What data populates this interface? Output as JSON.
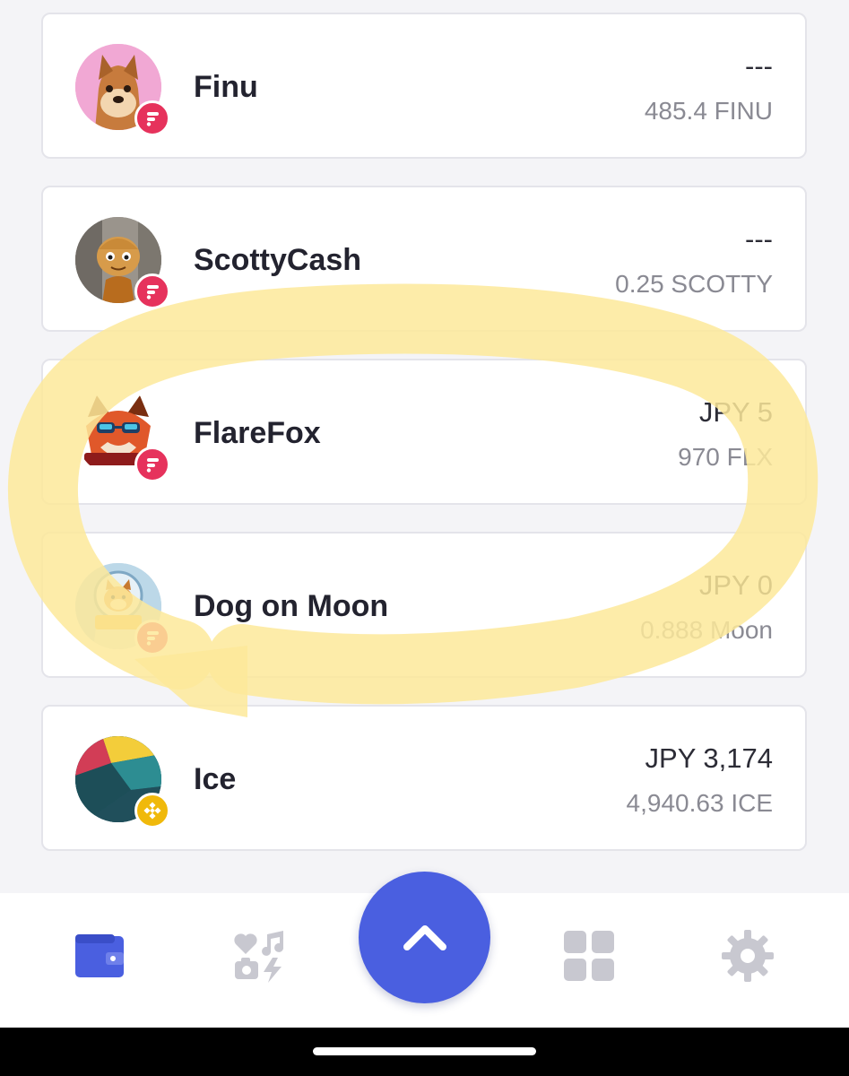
{
  "tokens": [
    {
      "name": "Finu",
      "fiat_value": "---",
      "amount": "485.4 FINU",
      "avatar_icon": "shiba-inu-photo",
      "chain_badge_icon": "flare-network-icon",
      "chain_badge_color": "#e6325c"
    },
    {
      "name": "ScottyCash",
      "fiat_value": "---",
      "amount": "0.25 SCOTTY",
      "avatar_icon": "cartoon-character-avatar",
      "chain_badge_icon": "flare-network-icon",
      "chain_badge_color": "#e6325c"
    },
    {
      "name": "FlareFox",
      "fiat_value": "JPY 5",
      "amount": "970 FLX",
      "avatar_icon": "fox-logo",
      "chain_badge_icon": "flare-network-icon",
      "chain_badge_color": "#e6325c"
    },
    {
      "name": "Dog on Moon",
      "fiat_value": "JPY 0",
      "amount": "0.888 Moon",
      "avatar_icon": "astronaut-dog-logo",
      "chain_badge_icon": "flare-network-icon",
      "chain_badge_color": "#e6325c"
    },
    {
      "name": "Ice",
      "fiat_value": "JPY 3,174",
      "amount": "4,940.63 ICE",
      "avatar_icon": "ice-network-logo",
      "chain_badge_icon": "bnb-chain-icon",
      "chain_badge_color": "#f0b90b"
    }
  ],
  "bottom_nav": {
    "items": [
      {
        "icon": "wallet-icon",
        "active": true
      },
      {
        "icon": "media-collectibles-icon",
        "active": false
      },
      {
        "icon": "apps-grid-icon",
        "active": false
      },
      {
        "icon": "settings-gear-icon",
        "active": false
      }
    ],
    "fab_icon": "chevron-up-icon"
  },
  "colors": {
    "accent": "#4a5fe0",
    "inactive_icon": "#c8c8d0",
    "highlight": "#fde99a",
    "background": "#f4f4f7",
    "card": "#ffffff"
  }
}
